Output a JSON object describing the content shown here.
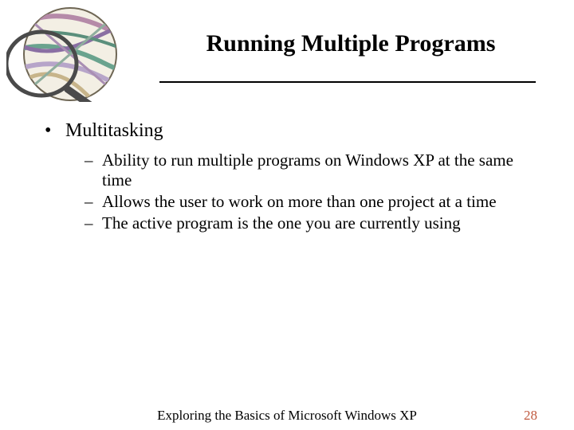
{
  "title": "Running Multiple Programs",
  "bullet": {
    "marker": "•",
    "text": "Multitasking"
  },
  "subs": [
    {
      "dash": "–",
      "text": "Ability to run multiple programs on Windows XP at the same time"
    },
    {
      "dash": "–",
      "text": "Allows the user to work on more than one project at a time"
    },
    {
      "dash": "–",
      "text": "The active program is the one you are currently using"
    }
  ],
  "footer": {
    "center": "Exploring the Basics of Microsoft Windows XP",
    "page": "28"
  },
  "colors": {
    "page_number": "#c05a40"
  }
}
